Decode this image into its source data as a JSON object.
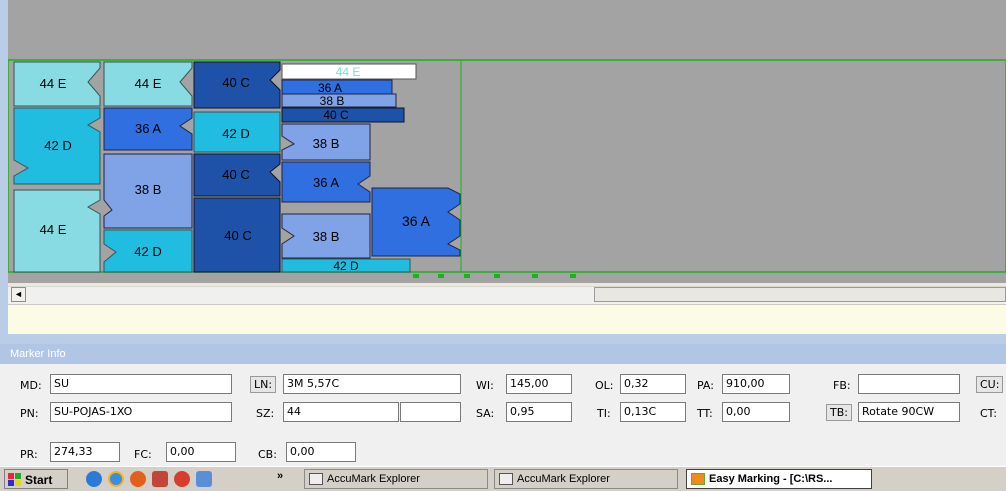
{
  "marker": {
    "pieces": [
      {
        "id": "p1",
        "label": "44 E",
        "color": "#88dbe3"
      },
      {
        "id": "p2",
        "label": "42 D",
        "color": "#20bde0"
      },
      {
        "id": "p3",
        "label": "44 E",
        "color": "#88dbe3"
      },
      {
        "id": "p4",
        "label": "44 E",
        "color": "#88dbe3"
      },
      {
        "id": "p5",
        "label": "36 A",
        "color": "#2f6fe0"
      },
      {
        "id": "p6",
        "label": "38 B",
        "color": "#7fa3e6"
      },
      {
        "id": "p7",
        "label": "42 D",
        "color": "#20bde0"
      },
      {
        "id": "p8",
        "label": "40 C",
        "color": "#1d52a8"
      },
      {
        "id": "p9",
        "label": "42 D",
        "color": "#20bde0"
      },
      {
        "id": "p10",
        "label": "40 C",
        "color": "#1d52a8"
      },
      {
        "id": "p11",
        "label": "40 C",
        "color": "#1d52a8"
      },
      {
        "id": "p12",
        "label": "44 E",
        "color": "#ffffff"
      },
      {
        "id": "p13",
        "label": "36 A",
        "color": "#2f6fe0"
      },
      {
        "id": "p14",
        "label": "38 B",
        "color": "#7fa3e6"
      },
      {
        "id": "p15",
        "label": "40 C",
        "color": "#1d52a8"
      },
      {
        "id": "p16",
        "label": "38 B",
        "color": "#7fa3e6"
      },
      {
        "id": "p17",
        "label": "36 A",
        "color": "#2f6fe0"
      },
      {
        "id": "p18",
        "label": "38 B",
        "color": "#7fa3e6"
      },
      {
        "id": "p19",
        "label": "42 D",
        "color": "#20bde0"
      },
      {
        "id": "p20",
        "label": "36 A",
        "color": "#2f6fe0"
      }
    ]
  },
  "scroll": {
    "left_arrow": "◄"
  },
  "info": {
    "title": "Marker Info",
    "labels": {
      "md": "MD:",
      "pn": "PN:",
      "pr": "PR:",
      "fc": "FC:",
      "ln": "LN:",
      "sz": "SZ:",
      "cb": "CB:",
      "wi": "WI:",
      "sa": "SA:",
      "ol": "OL:",
      "ti": "TI:",
      "pa": "PA:",
      "tt": "TT:",
      "fb": "FB:",
      "tb": "TB:",
      "cu": "CU:",
      "ct": "CT:"
    },
    "values": {
      "md": "SU",
      "pn": "SU-POJAS-1XO",
      "pr": "274,33",
      "fc": "0,00",
      "ln": "3M 5,57C",
      "sz": "44",
      "sz2": "",
      "cb": "0,00",
      "wi": "145,00",
      "sa": "0,95",
      "ol": "0,32",
      "ti": "0,13C",
      "pa": "910,00",
      "tt": "0,00",
      "fb": "",
      "tb": "Rotate 90CW"
    }
  },
  "taskbar": {
    "start": "Start",
    "more": "»",
    "tasks": [
      {
        "label": "AccuMark Explorer"
      },
      {
        "label": "AccuMark Explorer"
      },
      {
        "label": "Easy Marking - [C:\\RS..."
      }
    ]
  }
}
